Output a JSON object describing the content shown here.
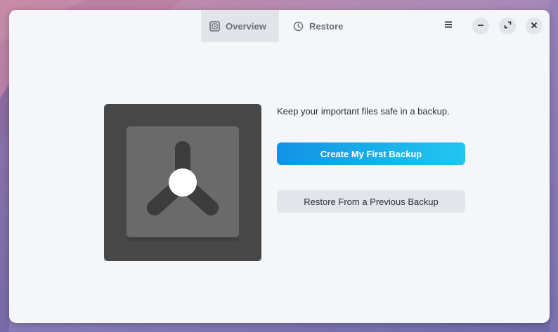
{
  "tabs": [
    {
      "label": "Overview",
      "icon": "safe-icon",
      "active": true
    },
    {
      "label": "Restore",
      "icon": "clock-icon",
      "active": false
    }
  ],
  "header_buttons": {
    "menu_icon": "hamburger-menu-icon",
    "minimize_icon": "minimize-icon",
    "maximize_icon": "maximize-icon",
    "close_icon": "close-icon"
  },
  "main": {
    "illustration": "vault-illustration",
    "tagline": "Keep your important files safe in a backup.",
    "primary_button": "Create My First Backup",
    "secondary_button": "Restore From a Previous Backup"
  },
  "colors": {
    "accent_start": "#1292e6",
    "accent_end": "#22c6f2",
    "window_bg": "#f5f6fa",
    "vault_dark": "#474747",
    "vault_door": "#6a6a6a"
  }
}
